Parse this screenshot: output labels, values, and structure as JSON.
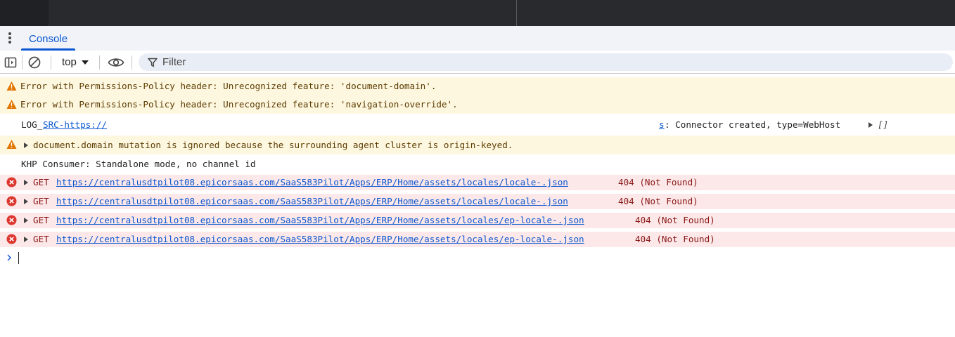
{
  "tabs": {
    "console": "Console"
  },
  "toolbar": {
    "context": "top",
    "filter_placeholder": "Filter"
  },
  "messages": [
    {
      "level": "warning",
      "text": "Error with Permissions-Policy header: Unrecognized feature: 'document-domain'."
    },
    {
      "level": "warning",
      "text": "Error with Permissions-Policy header: Unrecognized feature: 'navigation-override'."
    },
    {
      "level": "info",
      "prefix": "LOG_",
      "link_start": "SRC-https://",
      "link_end": "s",
      "text": ": Connector created, type=WebHost",
      "object_preview": "[]"
    },
    {
      "level": "warning",
      "text": "document.domain mutation is ignored because the surrounding agent cluster is origin-keyed."
    },
    {
      "level": "info",
      "text": "KHP Consumer: Standalone mode, no channel id"
    },
    {
      "level": "error",
      "method": "GET",
      "url": "https://centralusdtpilot08.epicorsaas.com/SaaS583Pilot/Apps/ERP/Home/assets/locales/locale-.json",
      "status": "404 (Not Found)"
    },
    {
      "level": "error",
      "method": "GET",
      "url": "https://centralusdtpilot08.epicorsaas.com/SaaS583Pilot/Apps/ERP/Home/assets/locales/locale-.json",
      "status": "404 (Not Found)"
    },
    {
      "level": "error",
      "method": "GET",
      "url": "https://centralusdtpilot08.epicorsaas.com/SaaS583Pilot/Apps/ERP/Home/assets/locales/ep-locale-.json",
      "status": "404 (Not Found)"
    },
    {
      "level": "error",
      "method": "GET",
      "url": "https://centralusdtpilot08.epicorsaas.com/SaaS583Pilot/Apps/ERP/Home/assets/locales/ep-locale-.json",
      "status": "404 (Not Found)"
    }
  ],
  "colors": {
    "accent": "#0b57d0",
    "warning_bg": "#fef7e0",
    "warning_icon": "#e37400",
    "error_bg": "#fce8e8",
    "error_icon": "#dc362e"
  },
  "icons": {
    "tab_menu": "kebab-icon",
    "sidebar": "sidebar-toggle-icon",
    "clear": "clear-console-icon",
    "live_expression": "eye-icon",
    "filter": "filter-icon",
    "warning": "warning-triangle-icon",
    "error": "error-circle-icon",
    "prompt": "chevron-right-icon"
  }
}
